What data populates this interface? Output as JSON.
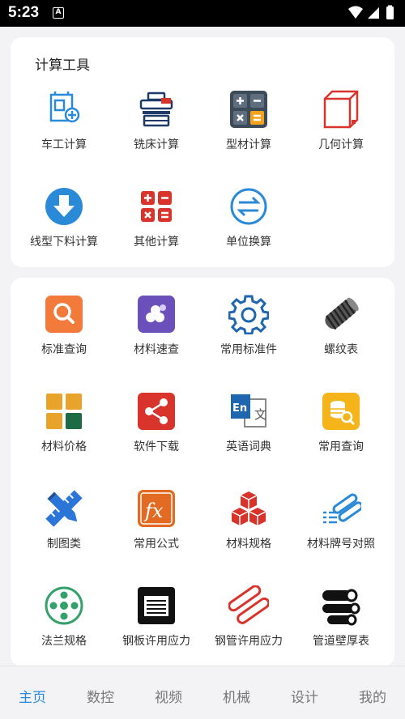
{
  "status_bar": {
    "time": "5:23",
    "notification_letter": "A"
  },
  "calc_section": {
    "title": "计算工具",
    "items": [
      {
        "label": "车工计算",
        "icon": "lathe-icon"
      },
      {
        "label": "铣床计算",
        "icon": "milling-machine-icon"
      },
      {
        "label": "型材计算",
        "icon": "calculator-icon"
      },
      {
        "label": "几何计算",
        "icon": "geometry-cube-icon"
      },
      {
        "label": "线型下料计算",
        "icon": "download-arrow-icon"
      },
      {
        "label": "其他计算",
        "icon": "math-operators-icon"
      },
      {
        "label": "单位换算",
        "icon": "convert-arrows-icon"
      }
    ]
  },
  "resources_section": {
    "items": [
      {
        "label": "标准查询",
        "icon": "search-icon"
      },
      {
        "label": "材料速查",
        "icon": "material-dots-icon"
      },
      {
        "label": "常用标准件",
        "icon": "gear-icon"
      },
      {
        "label": "螺纹表",
        "icon": "thread-screw-icon"
      },
      {
        "label": "材料价格",
        "icon": "grid-tiles-icon"
      },
      {
        "label": "软件下载",
        "icon": "share-icon"
      },
      {
        "label": "英语词典",
        "icon": "dictionary-icon"
      },
      {
        "label": "常用查询",
        "icon": "database-search-icon"
      },
      {
        "label": "制图类",
        "icon": "pencil-ruler-icon"
      },
      {
        "label": "常用公式",
        "icon": "formula-fx-icon"
      },
      {
        "label": "材料规格",
        "icon": "cubes-icon"
      },
      {
        "label": "材料牌号对照",
        "icon": "pipes-list-icon"
      },
      {
        "label": "法兰规格",
        "icon": "flange-icon"
      },
      {
        "label": "钢板许用应力",
        "icon": "steel-plate-icon"
      },
      {
        "label": "钢管许用应力",
        "icon": "steel-tubes-icon"
      },
      {
        "label": "管道壁厚表",
        "icon": "pipe-wall-icon"
      }
    ]
  },
  "bottom_nav": {
    "active": "主页",
    "items": [
      "主页",
      "数控",
      "视频",
      "机械",
      "设计",
      "我的"
    ]
  },
  "colors": {
    "active_tab": "#2b8ad8",
    "icon_blue": "#2b8ad8",
    "icon_red": "#d9342b",
    "icon_orange": "#f27b3c",
    "icon_purple": "#6b4fbb"
  }
}
